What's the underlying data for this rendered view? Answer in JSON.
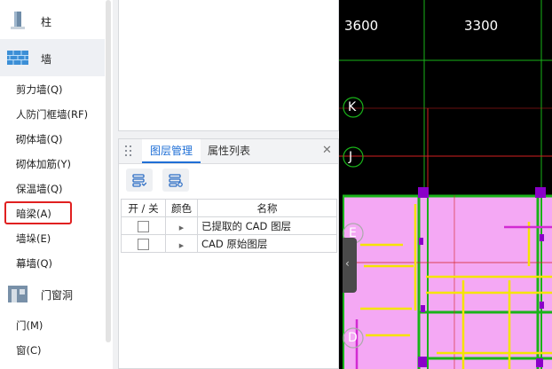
{
  "nav": {
    "groups": [
      {
        "icon": "column-icon",
        "label": "柱"
      },
      {
        "icon": "wall-icon",
        "label": "墙"
      },
      {
        "icon": "door-window-icon",
        "label": "门窗洞"
      }
    ],
    "wall_items": [
      "剪力墙(Q)",
      "人防门框墙(RF)",
      "砌体墙(Q)",
      "砌体加筋(Y)",
      "保温墙(Q)",
      "暗梁(A)",
      "墙垛(E)",
      "幕墙(Q)"
    ],
    "opening_items": [
      "门(M)",
      "窗(C)"
    ],
    "highlighted_item": "暗梁(A)"
  },
  "layer_panel": {
    "tabs": [
      "图层管理",
      "属性列表"
    ],
    "active_tab": "图层管理",
    "close_glyph": "✕",
    "toolbar": [
      {
        "icon": "layer-list-icon"
      },
      {
        "icon": "layer-settings-icon"
      }
    ],
    "columns": [
      "开 / 关",
      "颜色",
      "名称"
    ],
    "rows": [
      {
        "name": "已提取的 CAD 图层",
        "checked": false
      },
      {
        "name": "CAD 原始图层",
        "checked": false
      }
    ]
  },
  "cad": {
    "dimensions": [
      "3600",
      "3300"
    ],
    "axis_labels": [
      "K",
      "J",
      "E",
      "D"
    ],
    "colors": {
      "background": "#000000",
      "slab": "#f4a8f4",
      "axis_green": "#19b319",
      "axis_red": "#d42020",
      "beam_yellow": "#f5e400",
      "column_purple": "#8a00c8"
    },
    "handle_glyph": "‹"
  }
}
